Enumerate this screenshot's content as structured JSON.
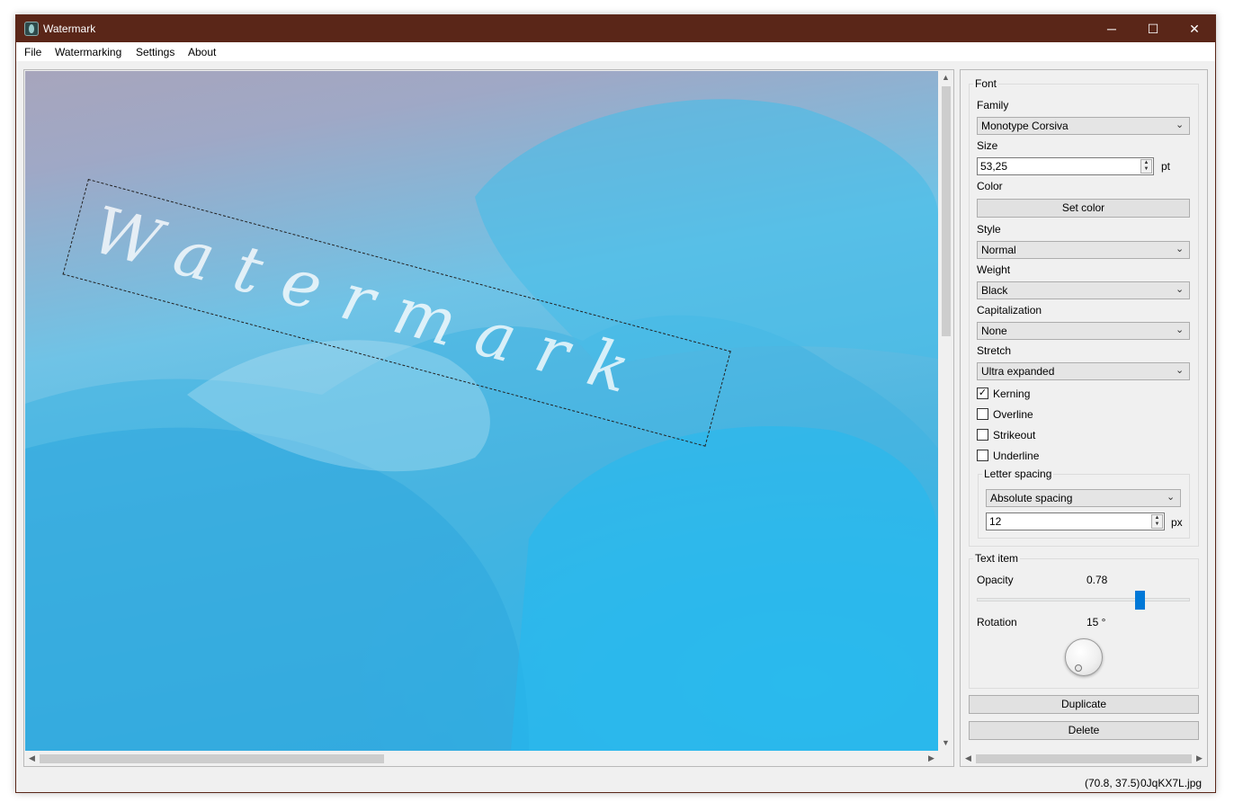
{
  "window": {
    "title": "Watermark",
    "controls": {
      "minimize": "─",
      "maximize": "☐",
      "close": "✕"
    }
  },
  "menu": [
    "File",
    "Watermarking",
    "Settings",
    "About"
  ],
  "canvas": {
    "watermark_text": "Watermark",
    "watermark_color": "#ffffff",
    "rotation_deg": 15,
    "opacity": 0.78
  },
  "panel": {
    "font_group": "Font",
    "family_label": "Family",
    "family_value": "Monotype Corsiva",
    "size_label": "Size",
    "size_value": "53,25",
    "size_unit": "pt",
    "color_label": "Color",
    "set_color_button": "Set color",
    "style_label": "Style",
    "style_value": "Normal",
    "weight_label": "Weight",
    "weight_value": "Black",
    "capitalization_label": "Capitalization",
    "capitalization_value": "None",
    "stretch_label": "Stretch",
    "stretch_value": "Ultra expanded",
    "checks": [
      {
        "label": "Kerning",
        "checked": true
      },
      {
        "label": "Overline",
        "checked": false
      },
      {
        "label": "Strikeout",
        "checked": false
      },
      {
        "label": "Underline",
        "checked": false
      }
    ],
    "letter_spacing_group": "Letter spacing",
    "letter_spacing_mode": "Absolute spacing",
    "letter_spacing_value": "12",
    "letter_spacing_unit": "px",
    "text_item_group": "Text item",
    "opacity_label": "Opacity",
    "opacity_value": "0.78",
    "rotation_label": "Rotation",
    "rotation_value": "15 °",
    "duplicate_button": "Duplicate",
    "delete_button": "Delete"
  },
  "status": {
    "coordinates": "(70.8, 37.5)",
    "filename": "0JqKX7L.jpg"
  },
  "icons": {
    "combo_arrow": "chevron-down-icon",
    "check_mark": "✓",
    "scroll_up": "▲",
    "scroll_down": "▼",
    "scroll_left": "◀",
    "scroll_right": "▶"
  },
  "colors": {
    "titlebar": "#5a2618",
    "slider_handle": "#0078d7"
  }
}
